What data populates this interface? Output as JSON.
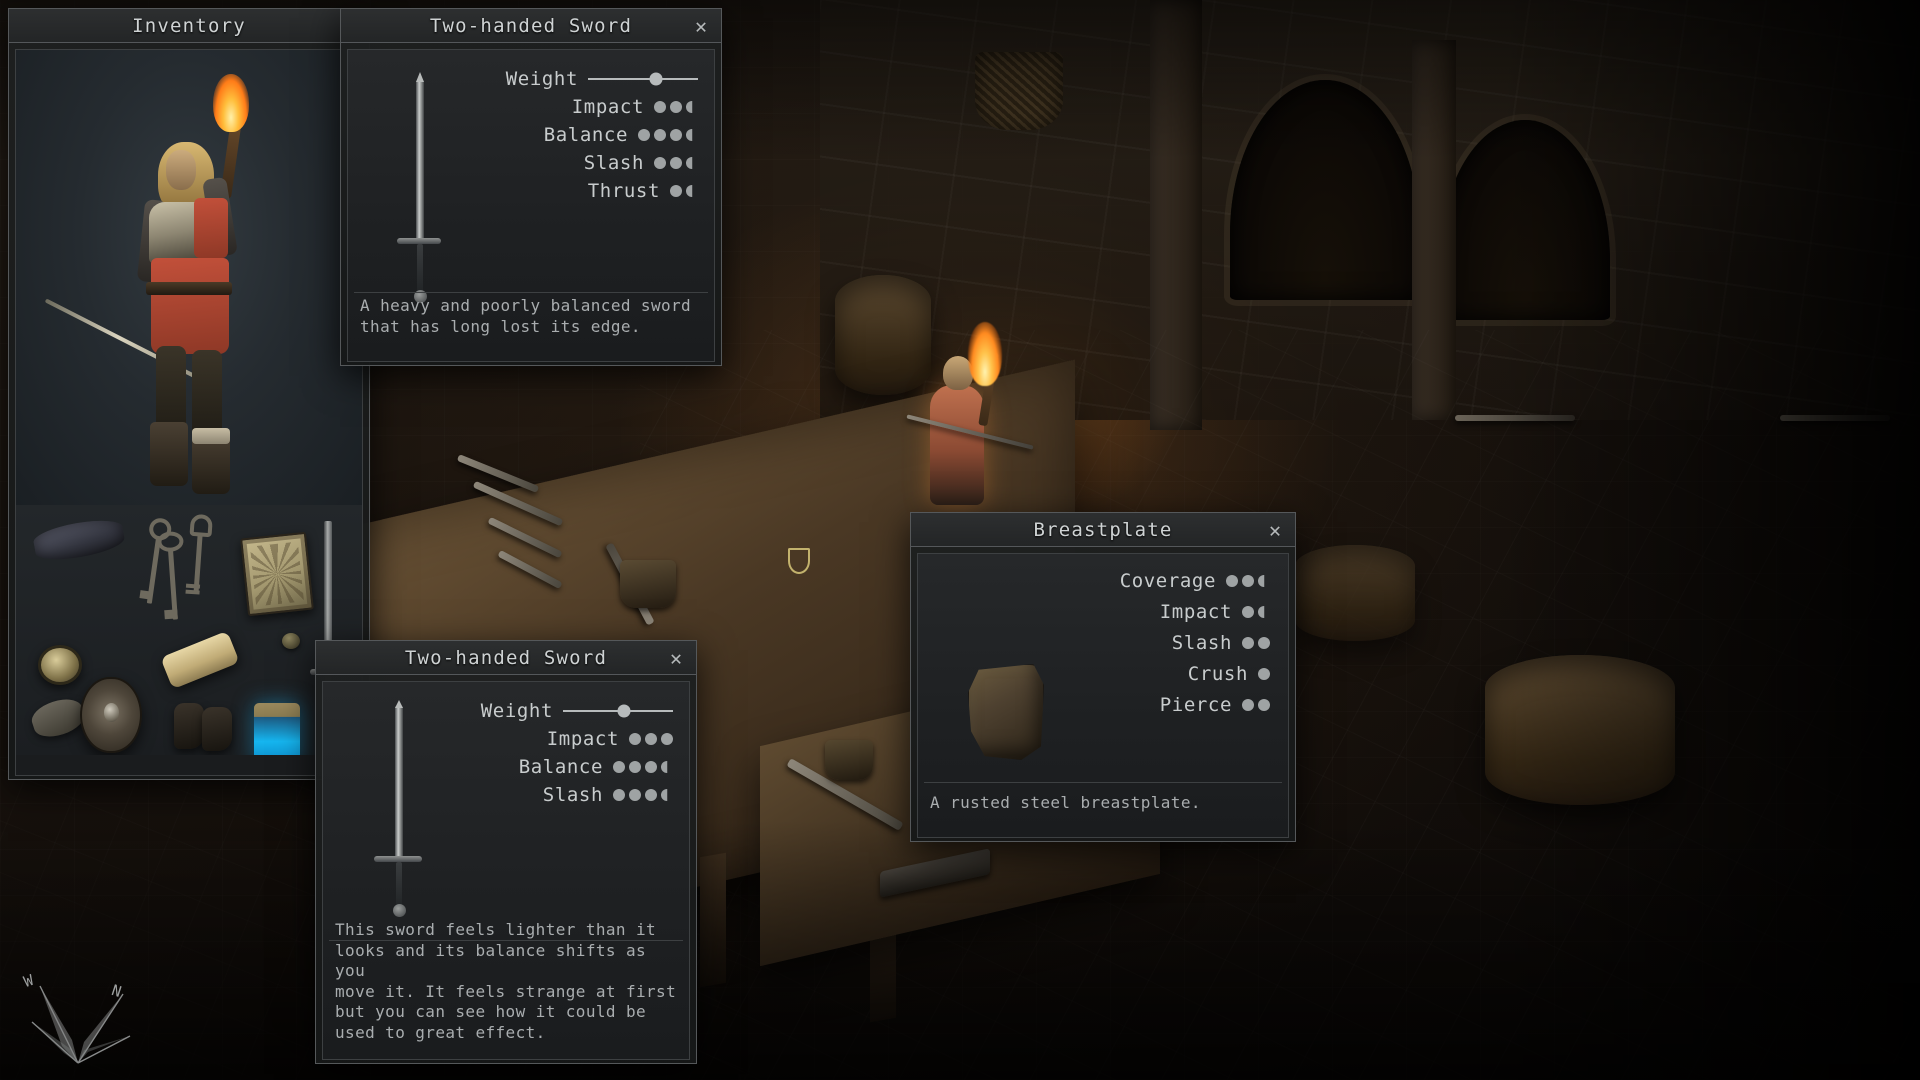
{
  "scene": {
    "description": "Isometric dungeon blacksmith workshop with stone floor, workbench, barrels, torch-bearing NPC",
    "compass": {
      "west_label": "W",
      "north_label": "N"
    }
  },
  "inventory_panel": {
    "title": "Inventory",
    "close_icon": "close-icon",
    "character": {
      "name": "player-character",
      "description": "Blonde woman in red tunic and steel breastplate holding a torch"
    },
    "items": [
      {
        "name": "bedroll",
        "label": "Bedroll"
      },
      {
        "name": "keys",
        "label": "Keys"
      },
      {
        "name": "book",
        "label": "Book"
      },
      {
        "name": "sword",
        "label": "Sword"
      },
      {
        "name": "compass",
        "label": "Compass"
      },
      {
        "name": "scroll",
        "label": "Scroll"
      },
      {
        "name": "coin",
        "label": "Coin"
      },
      {
        "name": "buckler",
        "label": "Buckler"
      },
      {
        "name": "boots",
        "label": "Boots"
      },
      {
        "name": "pads",
        "label": "Leather Pads"
      },
      {
        "name": "potion",
        "label": "Glowing Potion"
      }
    ]
  },
  "panels": [
    {
      "id": "sword-top",
      "title": "Two-handed Sword",
      "close_icon": "close-icon",
      "art": "two-handed-sword",
      "stats": [
        {
          "name": "Weight",
          "type": "slider",
          "value": 0.62
        },
        {
          "name": "Impact",
          "type": "pips",
          "full": 2,
          "half": 1
        },
        {
          "name": "Balance",
          "type": "pips",
          "full": 3,
          "half": 1
        },
        {
          "name": "Slash",
          "type": "pips",
          "full": 2,
          "half": 1
        },
        {
          "name": "Thrust",
          "type": "pips",
          "full": 1,
          "half": 1
        }
      ],
      "description": "A heavy and poorly balanced sword\nthat has long lost its edge."
    },
    {
      "id": "sword-bottom",
      "title": "Two-handed Sword",
      "close_icon": "close-icon",
      "art": "two-handed-sword",
      "stats": [
        {
          "name": "Weight",
          "type": "slider",
          "value": 0.55
        },
        {
          "name": "Impact",
          "type": "pips",
          "full": 3,
          "half": 0
        },
        {
          "name": "Balance",
          "type": "pips",
          "full": 3,
          "half": 1
        },
        {
          "name": "Slash",
          "type": "pips",
          "full": 3,
          "half": 1
        }
      ],
      "description": "This sword feels lighter than it\nlooks and its balance shifts as you\nmove it. It feels strange at first\nbut you can see how it could be\nused to great effect."
    },
    {
      "id": "breastplate",
      "title": "Breastplate",
      "close_icon": "close-icon",
      "art": "breastplate",
      "stats": [
        {
          "name": "Coverage",
          "type": "pips",
          "full": 2,
          "half": 1
        },
        {
          "name": "Impact",
          "type": "pips",
          "full": 1,
          "half": 1
        },
        {
          "name": "Slash",
          "type": "pips",
          "full": 2,
          "half": 0
        },
        {
          "name": "Crush",
          "type": "pips",
          "full": 1,
          "half": 0
        },
        {
          "name": "Pierce",
          "type": "pips",
          "full": 2,
          "half": 0
        }
      ],
      "description": "A rusted steel breastplate."
    }
  ],
  "colors": {
    "panel_bg": "#1e2022",
    "panel_border": "#55585a",
    "title_text": "#cfd3d4",
    "body_text": "#a9adaf",
    "pip": "#9fa3a4",
    "accent_flame": "#ff8a20"
  }
}
